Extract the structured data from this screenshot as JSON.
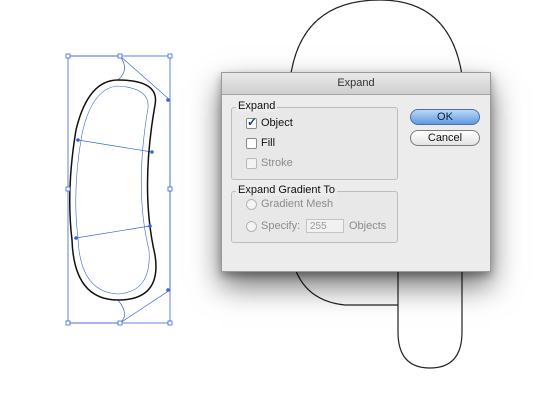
{
  "dialog": {
    "title": "Expand",
    "expand_group": {
      "label": "Expand",
      "object_label": "Object",
      "object_checked": true,
      "fill_label": "Fill",
      "fill_checked": false,
      "stroke_label": "Stroke",
      "stroke_enabled": false
    },
    "gradient_group": {
      "label": "Expand Gradient To",
      "gradient_mesh_label": "Gradient Mesh",
      "specify_label": "Specify:",
      "specify_value": "255",
      "objects_label": "Objects"
    },
    "ok_label": "OK",
    "cancel_label": "Cancel"
  },
  "colors": {
    "selection": "#3b64d4",
    "artwork_stroke": "#222222"
  }
}
